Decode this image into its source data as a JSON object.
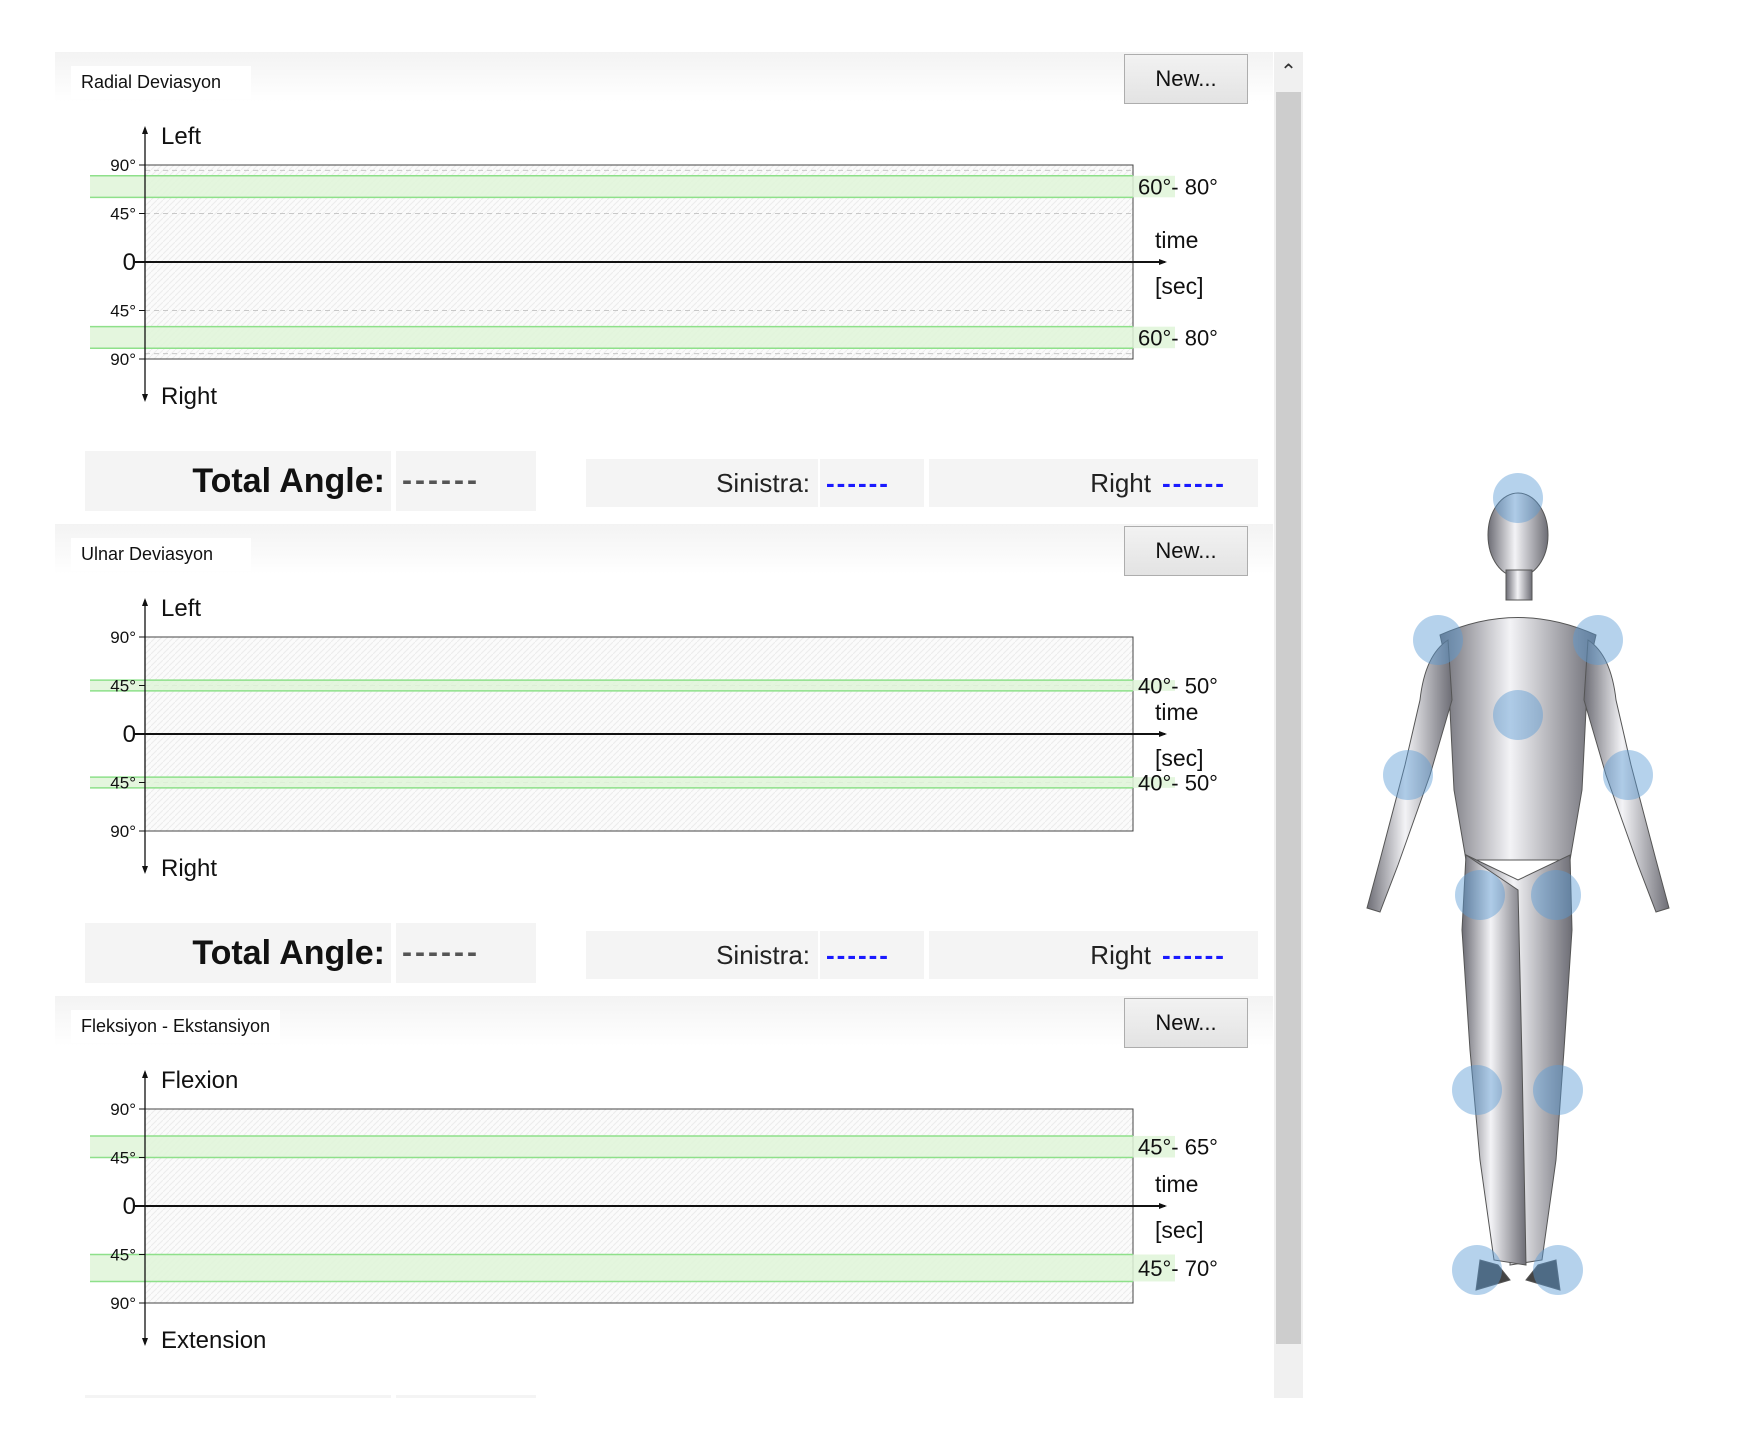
{
  "new_button_label": "New...",
  "time_label": "time",
  "sec_label": "[sec]",
  "zero_label": "0",
  "tick_90": "90°",
  "tick_45": "45°",
  "total_angle_label": "Total Angle:",
  "total_angle_value": "------",
  "sinistra_label": "Sinistra:",
  "sinistra_value": "------",
  "right_label": "Right",
  "right_value": "------",
  "colors": {
    "band_fill": "#dff5d8",
    "band_line": "#8ee08a",
    "value_blue": "#1a1aff",
    "joint_marker": "#5b9bd5"
  },
  "sections": [
    {
      "title": "Radial Deviasyon",
      "top_label": "Left",
      "bottom_label": "Right",
      "upper_range_label": "60°- 80°",
      "lower_range_label": "60°- 80°"
    },
    {
      "title": "Ulnar Deviasyon",
      "top_label": "Left",
      "bottom_label": "Right",
      "upper_range_label": "40°- 50°",
      "lower_range_label": "40°- 50°"
    },
    {
      "title": "Fleksiyon - Ekstansiyon",
      "top_label": "Flexion",
      "bottom_label": "Extension",
      "upper_range_label": "45°- 65°",
      "lower_range_label": "45°- 70°"
    }
  ],
  "chart_data": [
    {
      "type": "line",
      "title": "Radial Deviasyon",
      "xlabel": "time [sec]",
      "ylim": [
        -90,
        90
      ],
      "yticks": [
        90,
        45,
        0,
        -45,
        -90
      ],
      "normal_range_upper": [
        60,
        80
      ],
      "normal_range_lower": [
        60,
        80
      ],
      "series": []
    },
    {
      "type": "line",
      "title": "Ulnar Deviasyon",
      "xlabel": "time [sec]",
      "ylim": [
        -90,
        90
      ],
      "yticks": [
        90,
        45,
        0,
        -45,
        -90
      ],
      "normal_range_upper": [
        40,
        50
      ],
      "normal_range_lower": [
        40,
        50
      ],
      "series": []
    },
    {
      "type": "line",
      "title": "Fleksiyon - Ekstansiyon",
      "xlabel": "time [sec]",
      "ylim": [
        -90,
        90
      ],
      "yticks": [
        90,
        45,
        0,
        -45,
        -90
      ],
      "normal_range_upper": [
        45,
        65
      ],
      "normal_range_lower": [
        45,
        70
      ],
      "series": []
    }
  ],
  "figure": {
    "joints": [
      "head",
      "left-shoulder",
      "right-shoulder",
      "chest",
      "left-elbow",
      "right-elbow",
      "left-hip",
      "right-hip",
      "left-knee",
      "right-knee",
      "left-ankle",
      "right-ankle"
    ]
  }
}
